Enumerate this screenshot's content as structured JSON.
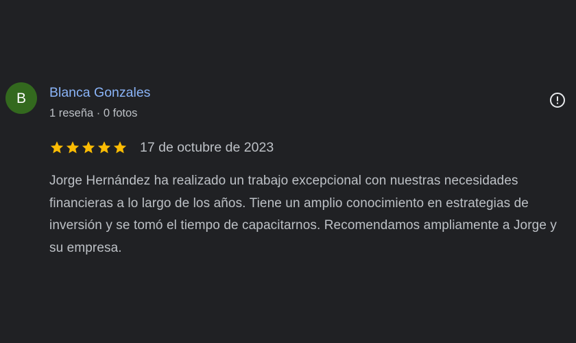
{
  "review": {
    "avatar_letter": "B",
    "avatar_color": "#33691e",
    "author_name": "Blanca Gonzales",
    "author_meta": "1 reseña · 0 fotos",
    "rating": 5,
    "rating_max": 5,
    "star_color": "#fbbc04",
    "date": "17 de octubre de 2023",
    "text": "Jorge Hernández ha realizado un trabajo excepcional con nuestras necesidades financieras a lo largo de los años. Tiene un amplio conocimiento en estrategias de inversión y se tomó el tiempo de capacitarnos. Recomendamos ampliamente a Jorge y su empresa.",
    "report_icon": "alert-circle-icon"
  }
}
